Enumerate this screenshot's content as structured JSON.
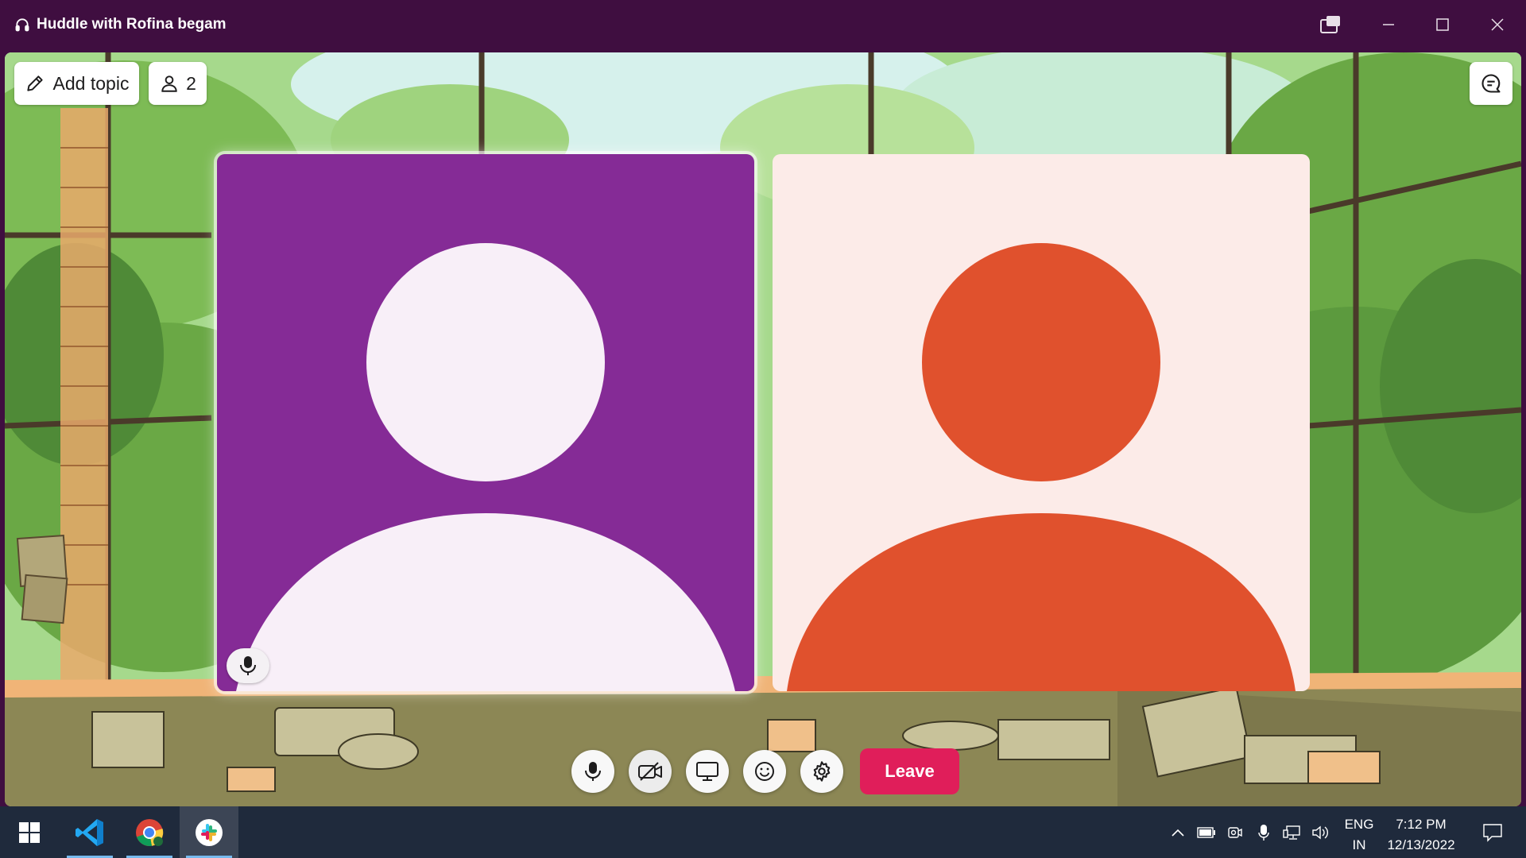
{
  "window": {
    "title": "Huddle with Rofina begam",
    "controls": [
      "pop-out",
      "minimize",
      "maximize",
      "close"
    ]
  },
  "huddle": {
    "add_topic_label": "Add topic",
    "participant_count": "2",
    "participants": [
      {
        "avatar_bg": "#852b96",
        "avatar_fg": "#f8eff8",
        "speaking": true,
        "mic": "on"
      },
      {
        "avatar_bg": "#fcebe8",
        "avatar_fg": "#e0512d",
        "speaking": false
      }
    ],
    "controls": {
      "mic": "on",
      "video": "off",
      "screen_share": "off",
      "leave_label": "Leave"
    }
  },
  "taskbar": {
    "pinned_apps": [
      "start",
      "visual-studio-code",
      "google-chrome",
      "slack"
    ],
    "language": {
      "line1": "ENG",
      "line2": "IN"
    },
    "time": "7:12 PM",
    "date": "12/13/2022"
  },
  "colors": {
    "titlebar": "#3f0e40",
    "leave": "#e01e5a",
    "taskbar": "#1f2a3c"
  }
}
